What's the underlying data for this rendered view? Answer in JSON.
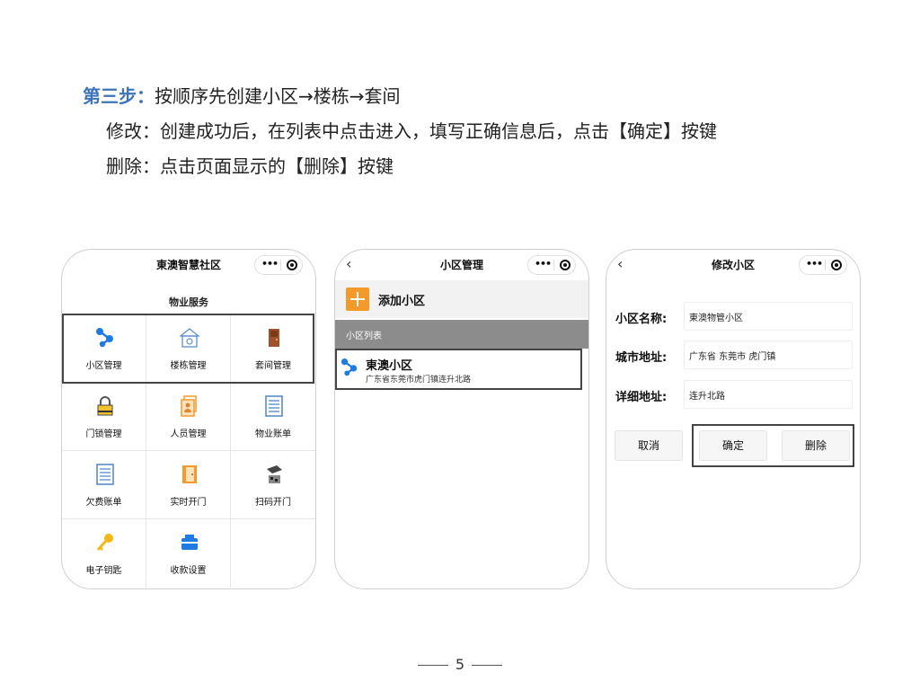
{
  "instructions": {
    "step_label": "第三步：",
    "step_text": "按顺序先创建小区→楼栋→套间",
    "modify": "修改：创建成功后，在列表中点击进入，填写正确信息后，点击【确定】按键",
    "delete": "删除：点击页面显示的【删除】按键"
  },
  "phone1": {
    "title": "東澳智慧社区",
    "section": "物业服务",
    "tiles": [
      {
        "label": "小区管理",
        "icon": "network-icon"
      },
      {
        "label": "楼栋管理",
        "icon": "building-icon"
      },
      {
        "label": "套间管理",
        "icon": "door-icon"
      },
      {
        "label": "门锁管理",
        "icon": "lock-icon"
      },
      {
        "label": "人员管理",
        "icon": "person-doc-icon"
      },
      {
        "label": "物业账单",
        "icon": "bill-icon"
      },
      {
        "label": "欠费账单",
        "icon": "bill-icon"
      },
      {
        "label": "实时开门",
        "icon": "open-door-icon"
      },
      {
        "label": "扫码开门",
        "icon": "qr-scan-icon"
      },
      {
        "label": "电子钥匙",
        "icon": "key-icon"
      },
      {
        "label": "收款设置",
        "icon": "payment-icon"
      }
    ]
  },
  "phone2": {
    "title": "小区管理",
    "add_label": "添加小区",
    "list_header": "小区列表",
    "item": {
      "name": "東澳小区",
      "address": "广东省东莞市虎门镇连升北路"
    }
  },
  "phone3": {
    "title": "修改小区",
    "fields": [
      {
        "label": "小区名称:",
        "value": "東澳物管小区"
      },
      {
        "label": "城市地址:",
        "value": "广东省 东莞市 虎门镇"
      },
      {
        "label": "详细地址:",
        "value": "连升北路"
      }
    ],
    "buttons": {
      "cancel": "取消",
      "confirm": "确定",
      "delete": "删除"
    }
  },
  "capsule": {
    "more": "•••"
  },
  "page_number": "5",
  "colors": {
    "step_blue": "#3d73b8",
    "accent_orange": "#f39a2b",
    "icon_blue": "#1e7be0",
    "list_header_gray": "#8c8c8c"
  }
}
